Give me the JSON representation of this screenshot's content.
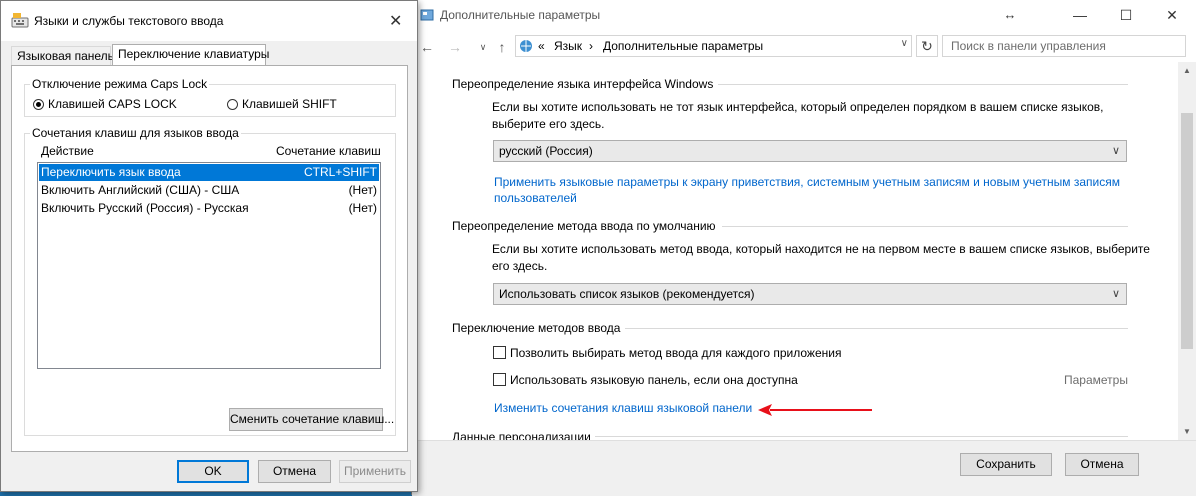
{
  "main_window": {
    "title": "Дополнительные параметры",
    "resize_glyph": "↔",
    "controls": {
      "minimize": "—",
      "maximize": "☐",
      "close": "✕"
    },
    "nav": {
      "back": "←",
      "forward": "→",
      "recent": "∨",
      "up": "↑"
    },
    "address": {
      "chevrons": "«",
      "crumb1": "Язык",
      "separator": "›",
      "crumb2": "Дополнительные параметры",
      "dropdown": "∨"
    },
    "refresh": "↻",
    "search_placeholder": "Поиск в панели управления",
    "sections": {
      "ui_language": {
        "title": "Переопределение языка интерфейса Windows",
        "description": "Если вы хотите использовать не тот язык интерфейса, который определен порядком в вашем списке языков, выберите его здесь.",
        "select_value": "русский (Россия)",
        "link": "Применить языковые параметры к экрану приветствия, системным учетным записям и новым учетным записям пользователей"
      },
      "input_method": {
        "title": "Переопределение метода ввода по умолчанию",
        "description": "Если вы хотите использовать метод ввода, который находится не на первом месте в вашем списке языков, выберите его здесь.",
        "select_value": "Использовать список языков (рекомендуется)"
      },
      "switching": {
        "title": "Переключение методов ввода",
        "checkbox1": "Позволить выбирать метод ввода для каждого приложения",
        "checkbox2": "Использовать языковую панель, если она доступна",
        "params_link": "Параметры",
        "hotkeys_link": "Изменить сочетания клавиш языковой панели"
      },
      "personalization": {
        "title": "Данные персонализации"
      }
    },
    "footer": {
      "save": "Сохранить",
      "cancel": "Отмена"
    },
    "arrow_color": "#e8101a"
  },
  "dialog": {
    "title": "Языки и службы текстового ввода",
    "close": "✕",
    "tabs": [
      "Языковая панель",
      "Переключение клавиатуры"
    ],
    "caps_lock_group": {
      "title": "Отключение режима Caps Lock",
      "options": [
        "Клавишей CAPS LOCK",
        "Клавишей SHIFT"
      ],
      "selected_index": 0
    },
    "hotkeys_group": {
      "title": "Сочетания клавиш для языков ввода",
      "columns": [
        "Действие",
        "Сочетание клавиш"
      ],
      "rows": [
        {
          "action": "Переключить язык ввода",
          "keys": "CTRL+SHIFT"
        },
        {
          "action": "Включить Английский (США) - США",
          "keys": "(Нет)"
        },
        {
          "action": "Включить Русский (Россия) - Русская",
          "keys": "(Нет)"
        }
      ],
      "change_button": "Сменить сочетание клавиш..."
    },
    "footer": {
      "ok": "OK",
      "cancel": "Отмена",
      "apply": "Применить"
    }
  }
}
